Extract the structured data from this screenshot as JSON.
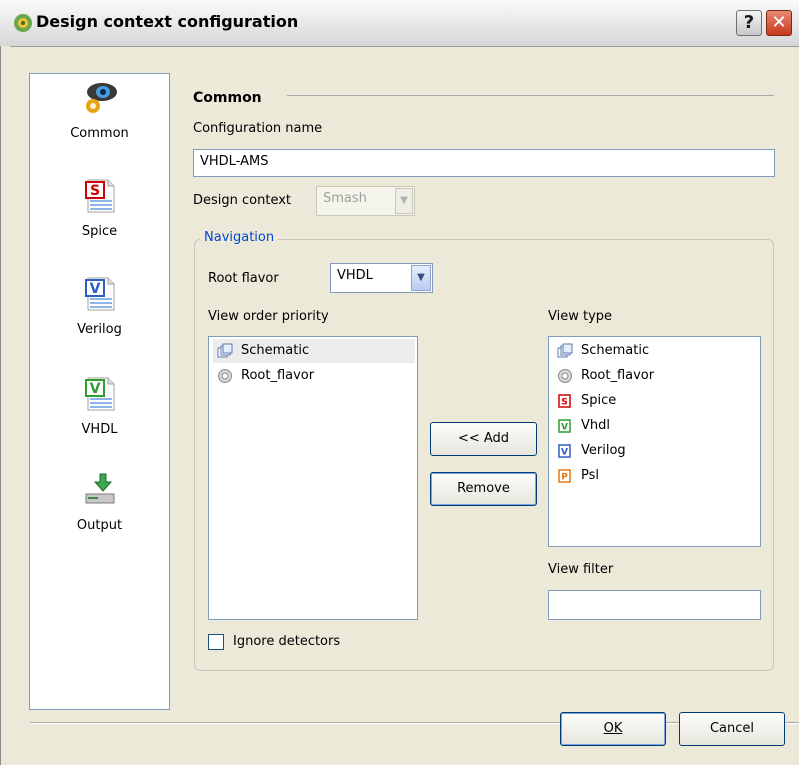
{
  "window": {
    "title": "Design context configuration",
    "help_glyph": "?",
    "close_glyph": "✕"
  },
  "sidebar": {
    "items": [
      {
        "label": "Common",
        "icon": "eye-gear-icon"
      },
      {
        "label": "Spice",
        "icon": "spice-file-icon",
        "badge": "S"
      },
      {
        "label": "Verilog",
        "icon": "verilog-file-icon",
        "badge": "V"
      },
      {
        "label": "VHDL",
        "icon": "vhdl-file-icon",
        "badge": "V"
      },
      {
        "label": "Output",
        "icon": "output-drive-icon"
      }
    ]
  },
  "common": {
    "section_title": "Common",
    "config_name_label": "Configuration name",
    "config_name_value": "VHDL-AMS",
    "design_context_label": "Design context",
    "design_context_value": "Smash"
  },
  "navigation": {
    "group_title": "Navigation",
    "root_flavor_label": "Root flavor",
    "root_flavor_value": "VHDL",
    "view_order_label": "View order priority",
    "view_order_items": [
      "Schematic",
      "Root_flavor"
    ],
    "view_type_label": "View type",
    "view_type_items": [
      "Schematic",
      "Root_flavor",
      "Spice",
      "Vhdl",
      "Verilog",
      "Psl"
    ],
    "add_button": "<< Add",
    "remove_button": "Remove",
    "view_filter_label": "View filter",
    "view_filter_value": "",
    "ignore_detectors_label": "Ignore detectors",
    "ignore_detectors_checked": false
  },
  "footer": {
    "ok_label": "OK",
    "cancel_label": "Cancel"
  },
  "colors": {
    "accent": "#0046d5",
    "dialog_bg": "#ece9d8",
    "border": "#7f9db9"
  }
}
